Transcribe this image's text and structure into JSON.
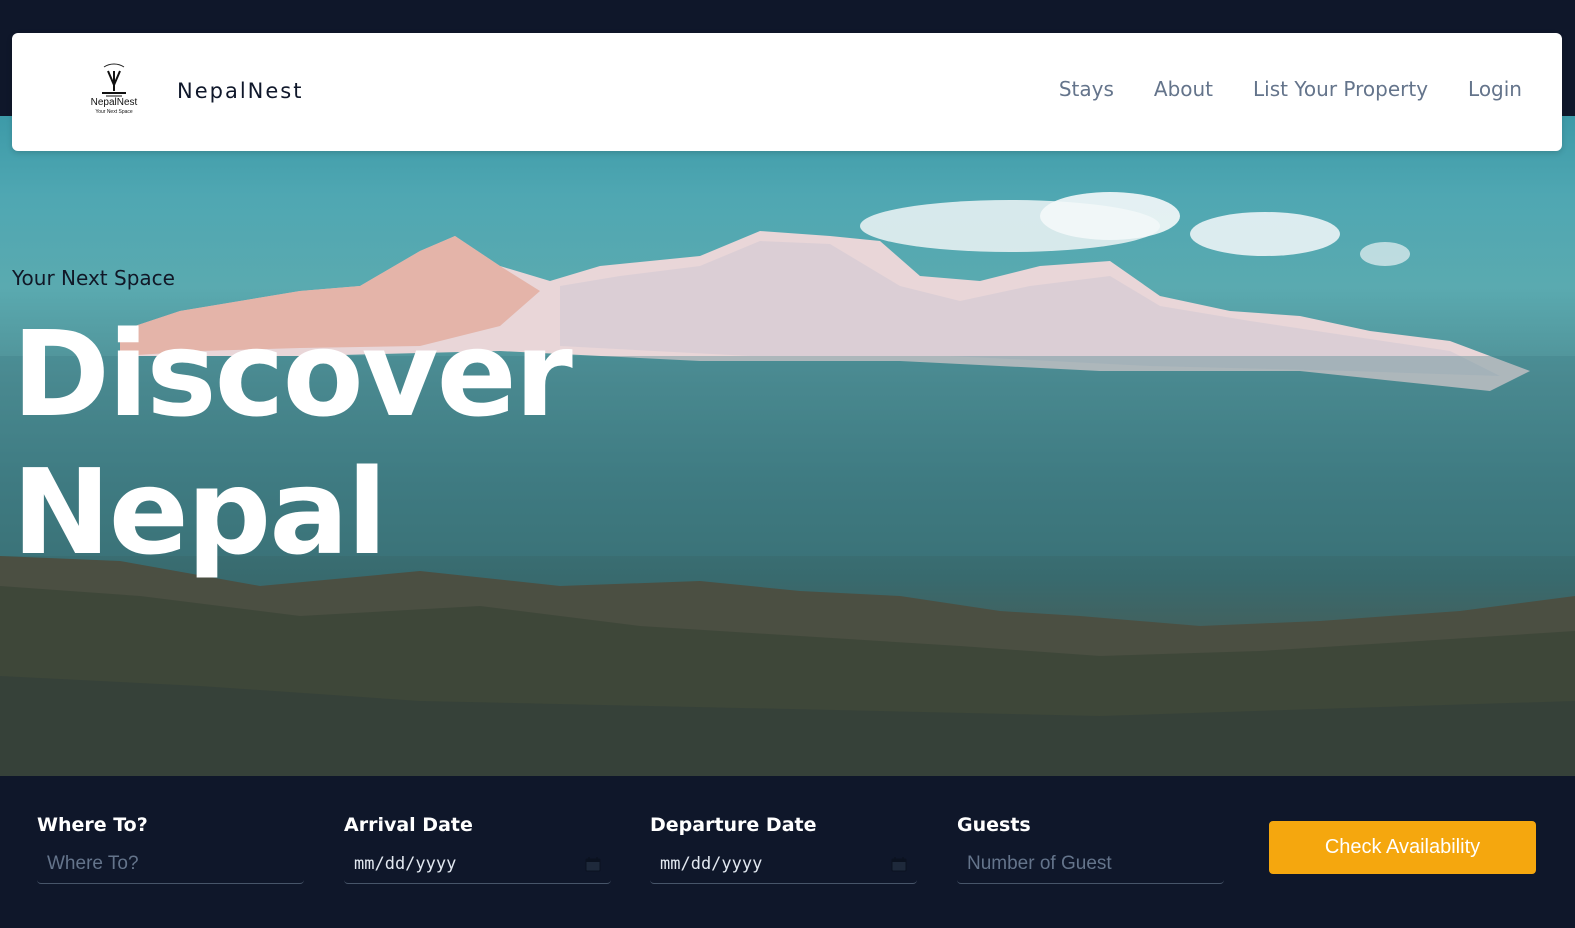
{
  "header": {
    "logo_name": "NepalNest",
    "logo_tagline": "Your Next Space",
    "brand": "NepalNest",
    "nav": [
      {
        "label": "Stays"
      },
      {
        "label": "About"
      },
      {
        "label": "List Your Property"
      },
      {
        "label": "Login"
      }
    ]
  },
  "hero": {
    "tagline": "Your Next Space",
    "headline_line1": "Discover",
    "headline_line2": "Nepal"
  },
  "search": {
    "where": {
      "label": "Where To?",
      "placeholder": "Where To?"
    },
    "arrival": {
      "label": "Arrival Date",
      "value": "mm/dd/yyyy"
    },
    "departure": {
      "label": "Departure Date",
      "value": "mm/dd/yyyy"
    },
    "guests": {
      "label": "Guests",
      "placeholder": "Number of Guest"
    },
    "button_label": "Check Availability"
  },
  "colors": {
    "accent": "#f5a70e",
    "background": "#0f172a",
    "nav_text": "#64748b"
  }
}
